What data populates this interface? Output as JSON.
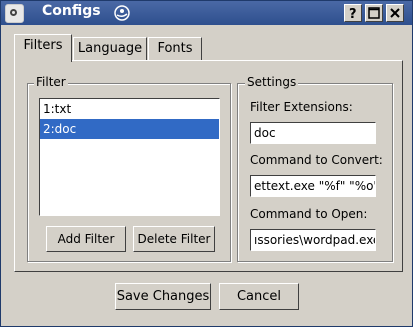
{
  "window": {
    "title": "Configs"
  },
  "tabs": [
    {
      "label": "Filters"
    },
    {
      "label": "Language"
    },
    {
      "label": "Fonts"
    }
  ],
  "filter_group": {
    "title": "Filter",
    "items": [
      "1:txt",
      "2:doc"
    ],
    "selected_index": 1,
    "add_label": "Add Filter",
    "delete_label": "Delete Filter"
  },
  "settings_group": {
    "title": "Settings",
    "ext_label": "Filter Extensions:",
    "ext_value": "doc",
    "convert_label": "Command to Convert:",
    "convert_value": "ettext.exe \"%f\" \"%o\"",
    "open_label": "Command to Open:",
    "open_value": "ıssories\\wordpad.exe"
  },
  "footer": {
    "save_label": "Save Changes",
    "cancel_label": "Cancel"
  },
  "colors": {
    "titlebar": "#3b5c9b",
    "selection": "#316ac5",
    "face": "#d4d0c8"
  }
}
